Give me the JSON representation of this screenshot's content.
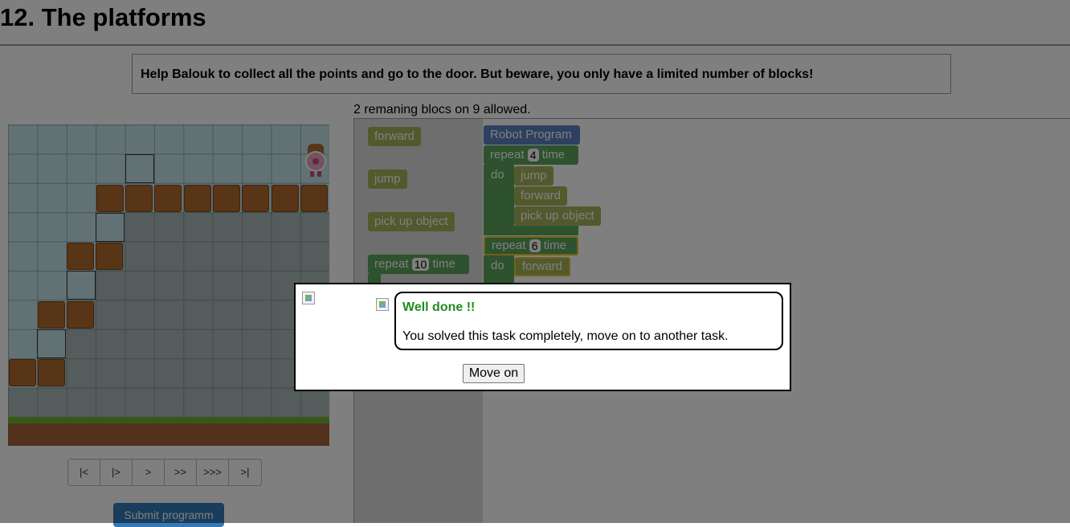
{
  "page": {
    "title": "12. The platforms"
  },
  "instructions": "Help Balouk to collect all the points and go to the door. But beware, you only have a limited number of blocks!",
  "remaining_text": "2 remaning blocs on 9 allowed.",
  "toolbox": {
    "forward": "forward",
    "jump": "jump",
    "pick_up": "pick up object",
    "repeat_label": "repeat",
    "repeat_count": "10",
    "time_label": "time"
  },
  "program": {
    "header": "Robot Program",
    "repeat_label": "repeat",
    "time_label": "time",
    "do_label": "do",
    "loop1_count": "4",
    "loop1_blocks": [
      "jump",
      "forward",
      "pick up object"
    ],
    "loop2_count": "6",
    "loop2_blocks": [
      "forward"
    ]
  },
  "controls": [
    "|<",
    "|>",
    ">",
    ">>",
    ">>>",
    ">|"
  ],
  "submit_label": "Submit programm",
  "dialog": {
    "title": "Well done !!",
    "message": "You solved this task completely, move on to another task.",
    "button": "Move on"
  },
  "colors": {
    "success": "#228b22",
    "submit": "#337ab7",
    "block_move": "#a5b55a",
    "block_loop": "#5ba55b",
    "block_head": "#5b80c0"
  }
}
